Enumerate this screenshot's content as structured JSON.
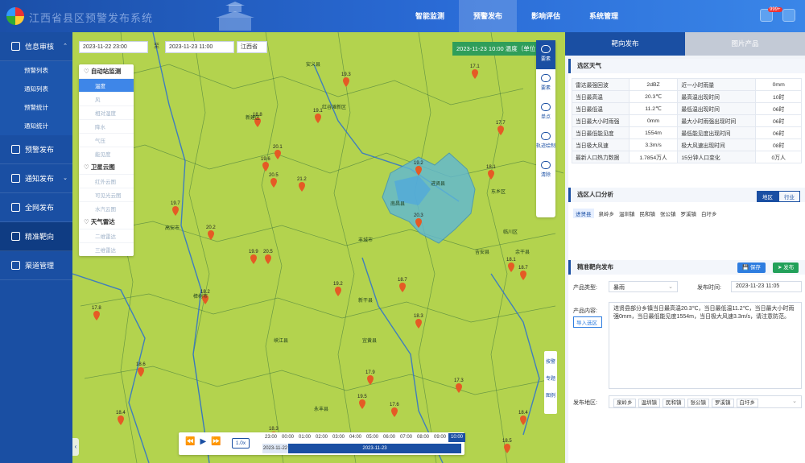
{
  "header": {
    "app_title": "江西省县区预警发布系统",
    "nav": [
      "智能监测",
      "预警发布",
      "影响评估",
      "系统管理"
    ],
    "active_nav": 1,
    "badge": "999+"
  },
  "sidebar": {
    "groups": [
      {
        "label": "信息审核",
        "icon": "document-icon",
        "expanded": true,
        "subs": [
          "预警列表",
          "通知列表",
          "预警统计",
          "通知统计"
        ]
      },
      {
        "label": "预警发布",
        "icon": "bell-icon"
      },
      {
        "label": "通知发布",
        "icon": "notice-icon",
        "arrow": "⌄"
      },
      {
        "label": "全网发布",
        "icon": "broadcast-icon"
      },
      {
        "label": "精准靶向",
        "icon": "target-icon",
        "active": true
      },
      {
        "label": "渠道管理",
        "icon": "channel-icon"
      }
    ]
  },
  "map": {
    "start_time": "2023-11-22 23:00",
    "to": "至",
    "end_time": "2023-11-23 11:00",
    "region": "江西省",
    "time_label": "2023-11-23 10:00 温度（单位：℃）",
    "layers": {
      "auto": {
        "title": "自动站监测",
        "items": [
          "温度",
          "风",
          "相对湿度",
          "降水",
          "气压",
          "能见度"
        ]
      },
      "sat": {
        "title": "卫星云图",
        "items": [
          "红外云图",
          "可见光云图",
          "水汽云图"
        ]
      },
      "radar": {
        "title": "天气雷达",
        "items": [
          "二维雷达",
          "三维雷达"
        ]
      }
    },
    "tools": [
      "要素",
      "要素",
      "单点",
      "轨迹绘制",
      "清除"
    ],
    "tools2": [
      "按警",
      "专题",
      "图例"
    ],
    "stations": [
      {
        "v": "19.1"
      },
      {
        "v": "18.8"
      },
      {
        "v": "19.3"
      },
      {
        "v": "20.1"
      },
      {
        "v": "19.6"
      },
      {
        "v": "20.5"
      },
      {
        "v": "21.2"
      },
      {
        "v": "19.2"
      },
      {
        "v": "17.7"
      },
      {
        "v": "18.1"
      },
      {
        "v": "20.3"
      },
      {
        "v": "19.7"
      },
      {
        "v": "20.2"
      },
      {
        "v": "19.9"
      },
      {
        "v": "20.5"
      },
      {
        "v": "18.1"
      },
      {
        "v": "18.7"
      },
      {
        "v": "19.2"
      },
      {
        "v": "18.7"
      },
      {
        "v": "18.2"
      },
      {
        "v": "18.3"
      },
      {
        "v": "18.6"
      },
      {
        "v": "17.9"
      },
      {
        "v": "17.3"
      },
      {
        "v": "19.5"
      },
      {
        "v": "18.4"
      },
      {
        "v": "18.3"
      },
      {
        "v": "18.5"
      },
      {
        "v": "17.8"
      },
      {
        "v": "17.1"
      },
      {
        "v": "18.4"
      },
      {
        "v": "17.6"
      }
    ],
    "places": [
      "安义县",
      "红谷滩新区",
      "新建区",
      "南昌县",
      "进贤县",
      "丰城市",
      "高安市",
      "樟树市",
      "新干县",
      "峡江县",
      "吉安县",
      "余干县",
      "东乡区",
      "临川区",
      "宜黄县",
      "永丰县"
    ],
    "timeline": {
      "speed": "1.0x",
      "hours": [
        "23:00",
        "00:00",
        "01:00",
        "02:00",
        "03:00",
        "04:00",
        "05:00",
        "06:00",
        "07:00",
        "08:00",
        "09:00",
        "10:00"
      ],
      "active_hour": 11,
      "day1": "2023-11-22",
      "day2": "2023-11-23"
    }
  },
  "right": {
    "tabs": [
      "靶向发布",
      "图片产品"
    ],
    "weather": {
      "title": "选区天气",
      "rows": [
        [
          "雷达最强回波",
          "2dBZ",
          "近一小时雨量",
          "0mm"
        ],
        [
          "当日最高温",
          "20.3℃",
          "最高温出现时间",
          "10时"
        ],
        [
          "当日最低温",
          "11.2℃",
          "最低温出现时间",
          "06时"
        ],
        [
          "当日最大小时雨强",
          "0mm",
          "最大小时雨强出现时间",
          "06时"
        ],
        [
          "当日最低能见度",
          "1554m",
          "最低能见度出现时间",
          "06时"
        ],
        [
          "当日极大风速",
          "3.3m/s",
          "极大风速出现时间",
          "08时"
        ],
        [
          "最新人口热力数据",
          "1.7854万人",
          "15分钟人口变化",
          "0万人"
        ]
      ]
    },
    "population": {
      "title": "选区人口分析",
      "toggle": [
        "地区",
        "行业"
      ],
      "towns": [
        "进贤县",
        "泉岭乡",
        "温圳镇",
        "民和镇",
        "张公镇",
        "罗溪镇",
        "白圩乡"
      ]
    },
    "publish": {
      "title": "精准靶向发布",
      "save": "保存",
      "send": "发布",
      "type_label": "产品类型:",
      "type_value": "暴雨",
      "time_label": "发布时间:",
      "time_value": "2023-11-23 11:05",
      "content_label": "产品内容:",
      "import_btn": "导入选区",
      "content": "进贤县部分乡镇当日最高温20.3℃，当日最低温11.2℃，当日最大小时雨强0mm，当日最低能见度1554m，当日极大风速3.3m/s，请注意防范。",
      "area_label": "发布地区:",
      "areas": [
        "泉岭乡",
        "温圳镇",
        "民和镇",
        "张公镇",
        "罗溪镇",
        "白圩乡"
      ]
    }
  }
}
